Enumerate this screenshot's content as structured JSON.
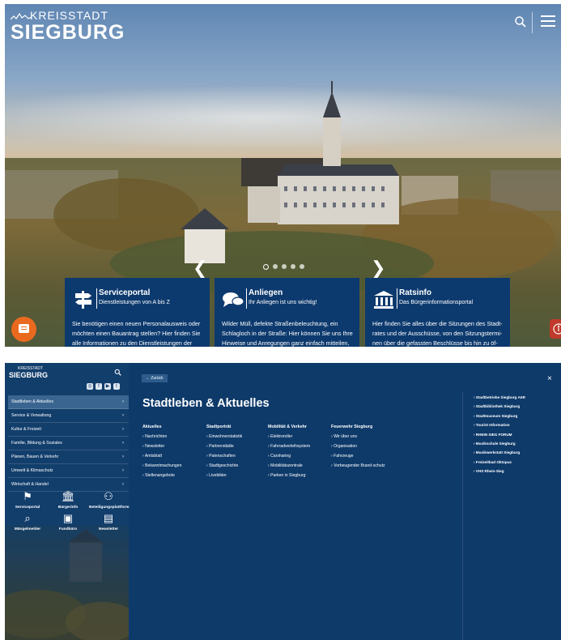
{
  "top": {
    "logo_small": "KREISSTADT",
    "logo_big": "SIEGBURG",
    "icons": [
      "search-icon",
      "hamburger-menu-icon",
      "chat-icon",
      "accessibility-icon"
    ],
    "prev_arrow": "❮",
    "next_arrow": "❯",
    "slider_dots": 5,
    "slider_active": 1,
    "cards": [
      {
        "title": "Serviceportal",
        "subtitle": "Dienstleistungen von A bis Z",
        "text": "Sie benötigen einen neuen Personalausweis oder möchten einen Bauantrag stellen? Hier finden Sie alle Informationen zu den Dienstleistungen der",
        "icon": "signpost-icon"
      },
      {
        "title": "Anliegen",
        "subtitle": "Ihr Anliegen ist uns wichtig!",
        "text": "Wilder Müll, defekte Straßenbeleuchtung, ein Schlagloch in der Straße: Hier können Sie uns Ihre Hinweise und Anregungen ganz einfach mitteilen,",
        "icon": "speech-bubbles-icon"
      },
      {
        "title": "Ratsinfo",
        "subtitle": "Das Bürgerinformationsportal",
        "text": "Hier finden Sie alles über die Sitzungen des Stadt-rates und der Ausschüsse, von den Sitzungstermi-nen über die gefassten Beschlüsse bis hin zu öf-",
        "icon": "columns-building-icon"
      }
    ],
    "colors": {
      "card_bg": "#0d3a6e",
      "chat_button": "#e96a1f",
      "accessibility_button": "#c0392b"
    }
  },
  "bottom": {
    "logo_small": "KREISSTADT",
    "logo_big": "SIEGBURG",
    "nav_items": [
      {
        "label": "Stadtleben & Aktuelles",
        "active": true
      },
      {
        "label": "Service & Verwaltung",
        "active": false
      },
      {
        "label": "Kultur & Freizeit",
        "active": false
      },
      {
        "label": "Familie, Bildung & Soziales",
        "active": false
      },
      {
        "label": "Planen, Bauen & Verkehr",
        "active": false
      },
      {
        "label": "Umwelt & Klimaschutz",
        "active": false
      },
      {
        "label": "Wirtschaft & Handel",
        "active": false
      }
    ],
    "nav_chevron": "›",
    "quick_links": [
      {
        "label": "Serviceportal",
        "icon": "signpost-icon",
        "glyph": "⚑"
      },
      {
        "label": "Bürgerinfo",
        "icon": "columns-building-icon",
        "glyph": "🏛"
      },
      {
        "label": "Beteiligungsplattform",
        "icon": "people-network-icon",
        "glyph": "⚇"
      },
      {
        "label": "Mängelmelder",
        "icon": "magnifier-chat-icon",
        "glyph": "⌕"
      },
      {
        "label": "Fundbüro",
        "icon": "box-icon",
        "glyph": "▣"
      },
      {
        "label": "Newsletter",
        "icon": "newspaper-icon",
        "glyph": "▤"
      }
    ],
    "back_label": "← Zurück",
    "close_label": "×",
    "title": "Stadtleben & Aktuelles",
    "columns": [
      {
        "heading": "Aktuelles",
        "links": [
          "Nachrichten",
          "Newsletter",
          "Amtsblatt",
          "Bekanntmachungen",
          "Stellenangebote"
        ]
      },
      {
        "heading": "Stadtporträt",
        "links": [
          "Einwohnerstatistik",
          "Partnerstädte",
          "Patenschaften",
          "Stadtgeschichte",
          "Livebilder"
        ]
      },
      {
        "heading": "Mobilität & Verkehr",
        "links": [
          "Elektroroller",
          "Fahrradverleihsystem",
          "Carsharing",
          "Mobilitätszentrale",
          "Parken in Siegburg"
        ]
      },
      {
        "heading": "Feuerwehr Siegburg",
        "links": [
          "Wir über uns",
          "Organisation",
          "Fahrzeuge",
          "Vorbeugender Brand-schutz"
        ]
      }
    ],
    "right_links": [
      "Stadtbetriebe Siegburg AöR",
      "Stadtbibliothek Siegburg",
      "Stadtmuseum Siegburg",
      "Tourist Information",
      "RHEIN SIEG FORUM",
      "Musikschule Siegburg",
      "Musikwerkstatt Siegburg",
      "Freizeitbad Oktopus",
      "VHS Rhein-Sieg"
    ],
    "link_prefix": "›",
    "colors": {
      "panel_bg": "#0e3a6a",
      "sidebar_bg": "#123e6c",
      "active_nav": "#3a6590"
    }
  }
}
